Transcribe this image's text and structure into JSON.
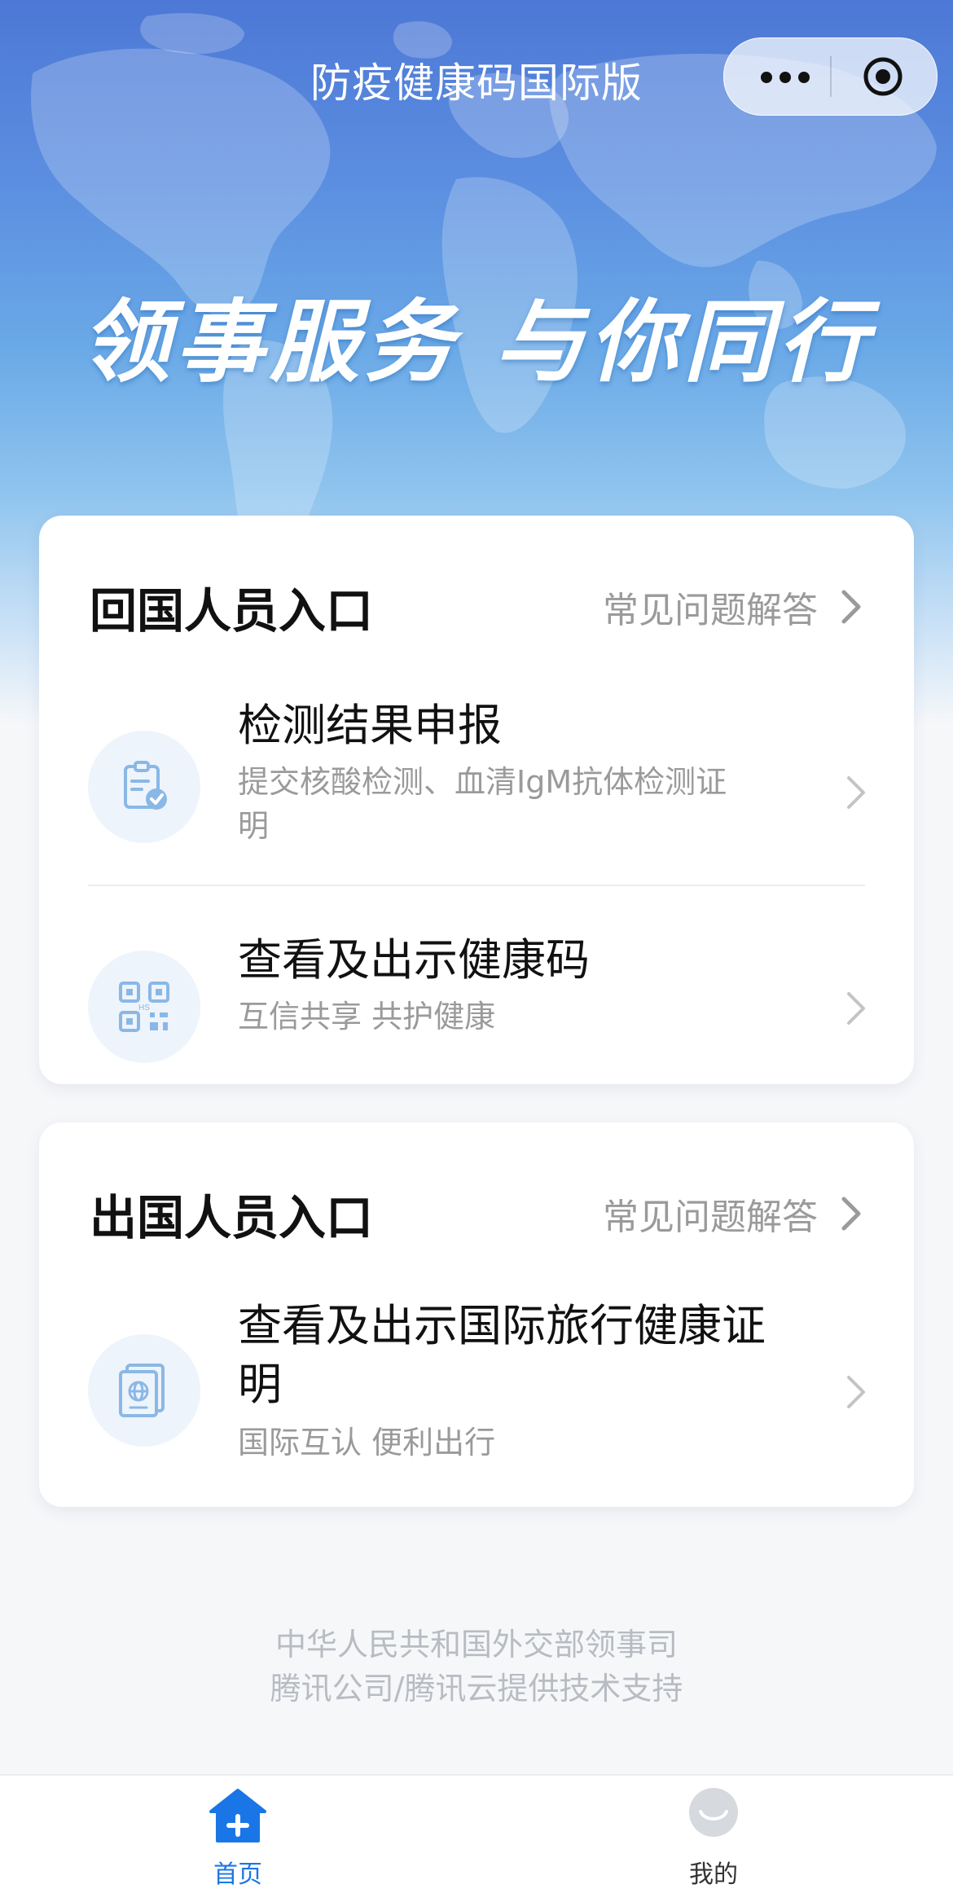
{
  "nav": {
    "title": "防疫健康码国际版"
  },
  "hero": {
    "slogan": "领事服务 与你同行"
  },
  "return_entry": {
    "title": "回国人员入口",
    "faq_label": "常见问题解答",
    "items": [
      {
        "icon": "clipboard-check-icon",
        "title": "检测结果申报",
        "subtitle_line1": "提交核酸检测、血清IgM抗体检测证",
        "subtitle_line2": "明"
      },
      {
        "icon": "health-qr-code-icon",
        "title": "查看及出示健康码",
        "subtitle_line1": "互信共享 共护健康"
      }
    ]
  },
  "exit_entry": {
    "title": "出国人员入口",
    "faq_label": "常见问题解答",
    "items": [
      {
        "icon": "passport-icon",
        "title_line1": "查看及出示国际旅行健康证",
        "title_line2": "明",
        "subtitle_line1": "国际互认 便利出行"
      }
    ]
  },
  "footer": {
    "line1": "中华人民共和国外交部领事司",
    "line2": "腾讯公司/腾讯云提供技术支持"
  },
  "tabbar": {
    "tabs": [
      {
        "label": "首页",
        "icon": "home-plus-icon",
        "active": true
      },
      {
        "label": "我的",
        "icon": "profile-avatar-icon",
        "active": false
      }
    ]
  },
  "colors": {
    "accent": "#1a76e6",
    "hero_top": "#4d78d6",
    "hero_bottom": "#cfe4f7",
    "icon_tint": "#8ab8e6"
  }
}
